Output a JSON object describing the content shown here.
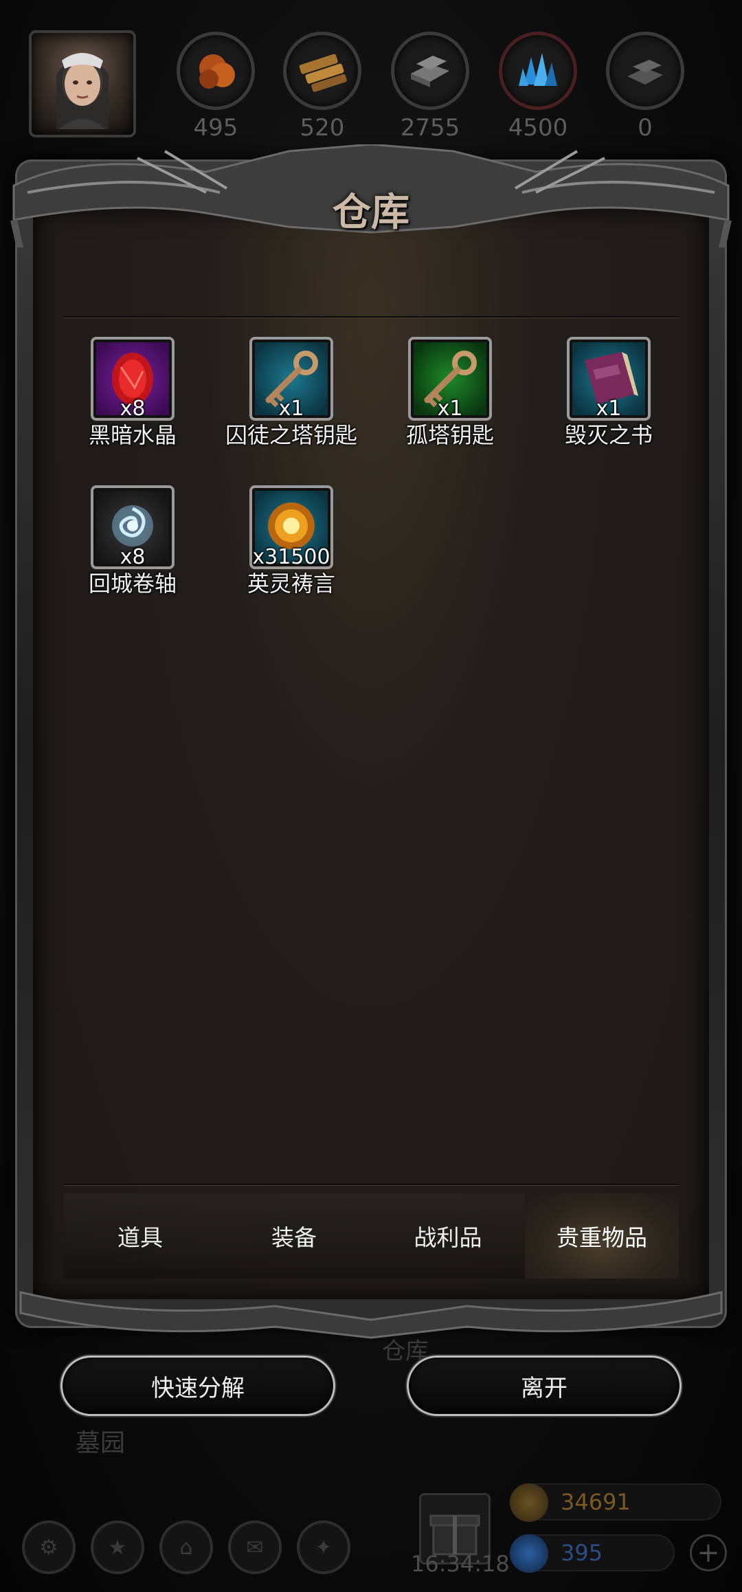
{
  "resources": [
    {
      "value": "495",
      "icon": "ore-icon"
    },
    {
      "value": "520",
      "icon": "wood-icon"
    },
    {
      "value": "2755",
      "icon": "iron-icon"
    },
    {
      "value": "4500",
      "icon": "crystal-icon"
    },
    {
      "value": "0",
      "icon": "ingot-icon"
    }
  ],
  "panel": {
    "title": "仓库"
  },
  "items": [
    {
      "name": "黑暗水晶",
      "qty": "x8",
      "rarity": "purple",
      "icon": "dark-crystal-icon"
    },
    {
      "name": "囚徒之塔钥匙",
      "qty": "x1",
      "rarity": "blue",
      "icon": "key-icon"
    },
    {
      "name": "孤塔钥匙",
      "qty": "x1",
      "rarity": "green",
      "icon": "key-icon"
    },
    {
      "name": "毁灭之书",
      "qty": "x1",
      "rarity": "blue",
      "icon": "book-icon"
    },
    {
      "name": "回城卷轴",
      "qty": "x8",
      "rarity": "gray",
      "icon": "town-portal-scroll-icon"
    },
    {
      "name": "英灵祷言",
      "qty": "x31500",
      "rarity": "blue",
      "icon": "hero-prayer-orb-icon"
    }
  ],
  "tabs": [
    {
      "label": "道具",
      "active": false
    },
    {
      "label": "装备",
      "active": false
    },
    {
      "label": "战利品",
      "active": false
    },
    {
      "label": "贵重物品",
      "active": true
    }
  ],
  "under_label": "仓库",
  "buttons": {
    "quick_decompose": "快速分解",
    "leave": "离开"
  },
  "area_label": "墓园",
  "hud": {
    "time": "16:34:18",
    "gold": "34691",
    "diamonds": "395",
    "gold_color": "#7a5a22",
    "diamond_color": "#2a4d86"
  }
}
